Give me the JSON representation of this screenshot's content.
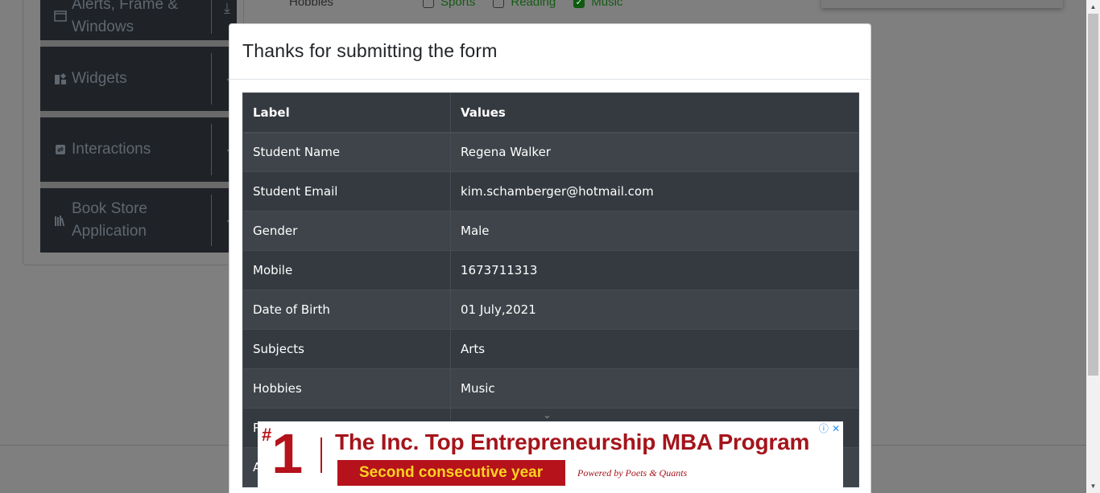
{
  "sidebar": {
    "groups": [
      {
        "label": "Alerts, Frame & Windows",
        "icon": "window-icon"
      },
      {
        "label": "Widgets",
        "icon": "widgets-icon"
      },
      {
        "label": "Interactions",
        "icon": "interactions-icon"
      },
      {
        "label": "Book Store Application",
        "icon": "books-icon"
      }
    ]
  },
  "form_bg": {
    "hobbies_label": "Hobbies",
    "options": [
      {
        "label": "Sports",
        "checked": false
      },
      {
        "label": "Reading",
        "checked": false
      },
      {
        "label": "Music",
        "checked": true
      }
    ]
  },
  "modal": {
    "title": "Thanks for submitting the form",
    "headers": {
      "label": "Label",
      "values": "Values"
    },
    "rows": [
      {
        "label": "Student Name",
        "value": "Regena Walker"
      },
      {
        "label": "Student Email",
        "value": "kim.schamberger@hotmail.com"
      },
      {
        "label": "Gender",
        "value": "Male"
      },
      {
        "label": "Mobile",
        "value": "1673711313"
      },
      {
        "label": "Date of Birth",
        "value": "01 July,2021"
      },
      {
        "label": "Subjects",
        "value": "Arts"
      },
      {
        "label": "Hobbies",
        "value": "Music"
      },
      {
        "label": "P",
        "value": ""
      },
      {
        "label": "A",
        "value": ""
      }
    ]
  },
  "ad": {
    "rank_hash": "#",
    "rank_number": "1",
    "headline": "The Inc. Top Entrepreneurship MBA Program",
    "tagline": "Second consecutive year",
    "powered_by": "Powered by Poets & Quants",
    "colors": {
      "brand_red": "#b5121b",
      "tag_text": "#ffd21f"
    }
  }
}
